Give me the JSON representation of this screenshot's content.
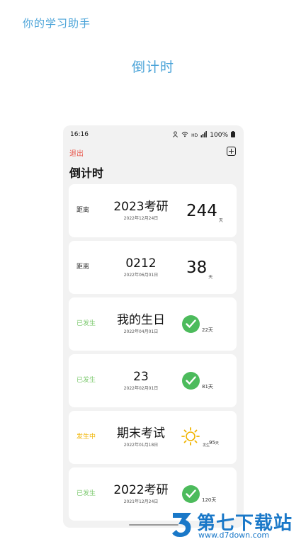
{
  "header": {
    "app_title": "你的学习助手",
    "promo_title": "倒计时"
  },
  "status_bar": {
    "time": "16:16",
    "indicators": "HD",
    "battery": "100%"
  },
  "toolbar": {
    "exit_label": "退出",
    "add_icon": "plus-square-icon"
  },
  "screen_title": "倒计时",
  "events": [
    {
      "status": "距离",
      "name": "2023考研",
      "date": "2022年12月24日",
      "days": "244",
      "unit": "天"
    },
    {
      "status": "距离",
      "name": "0212",
      "date": "2022年06月01日",
      "days": "38",
      "unit": "天"
    },
    {
      "status": "已发生",
      "name": "我的生日",
      "date": "2022年04月01日",
      "days": "22",
      "unit": "天"
    },
    {
      "status": "已发生",
      "name": "23",
      "date": "2022年02月01日",
      "days": "81",
      "unit": "天"
    },
    {
      "status": "发生中",
      "name": "期末考试",
      "date": "2022年01月18日",
      "days": "95",
      "unit": "天",
      "sub_label": "发生"
    },
    {
      "status": "已发生",
      "name": "2022考研",
      "date": "2021年12月24日",
      "days": "120",
      "unit": "天"
    }
  ],
  "colors": {
    "accent": "#4aa3d8",
    "exit": "#e85a4f",
    "done": "#7cc96e",
    "check": "#4cbb5c",
    "active": "#f0b400"
  },
  "watermark": {
    "brand": "第七下载站",
    "url": "www.d7down.com"
  }
}
